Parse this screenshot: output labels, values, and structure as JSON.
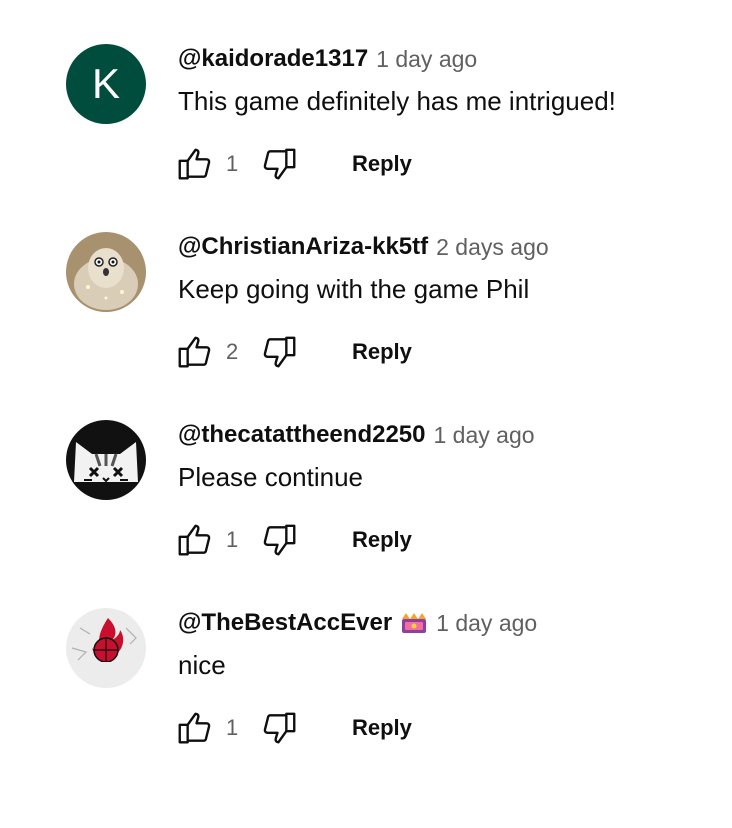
{
  "comments": [
    {
      "avatar_letter": "K",
      "author": "@kaidorade1317",
      "time": "1 day ago",
      "text": "This game definitely has me intrigued!",
      "likes": "1",
      "reply_label": "Reply",
      "avatar_icon": "letter-avatar",
      "avatar_color": "#004d3d"
    },
    {
      "author": "@ChristianAriza-kk5tf",
      "time": "2 days ago",
      "text": "Keep going with the game Phil",
      "likes": "2",
      "reply_label": "Reply",
      "avatar_icon": "sparkly-blob-avatar"
    },
    {
      "author": "@thecatattheend2250",
      "time": "1 day ago",
      "text": "Please continue",
      "likes": "1",
      "reply_label": "Reply",
      "avatar_icon": "cat-face-avatar"
    },
    {
      "author": "@TheBestAccEver",
      "time": "1 day ago",
      "text": "nice",
      "likes": "1",
      "reply_label": "Reply",
      "avatar_icon": "miami-heat-logo-avatar",
      "badge_icon": "member-crown-badge"
    }
  ],
  "colors": {
    "secondary_text": "#606060",
    "primary_text": "#0f0f0f"
  }
}
